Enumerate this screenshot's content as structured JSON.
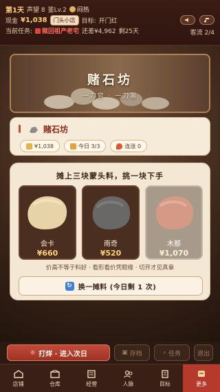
{
  "status": {
    "day": "第1天",
    "reputation": "声望 8",
    "eye": "鉴Lv.2",
    "heat": "闷热",
    "cash_label": "现金",
    "cash": "¥1,038",
    "shop_badge": "门头小店",
    "goal_label": "目标:",
    "goal": "开门红",
    "task_label": "当前任务:",
    "task_name": "赎回祖产老宅",
    "task_gap": "还差¥4,962",
    "task_days": "剩25天",
    "guests": "客流 2/4"
  },
  "banner": {
    "title": "赌石坊",
    "subtitle": "一刀穷 · 一刀富"
  },
  "info": {
    "title": "赌石坊",
    "chips": [
      {
        "label": "¥1,038",
        "icon": "coin-icon"
      },
      {
        "label": "今日 3/3",
        "icon": "ticket-icon"
      },
      {
        "label": "连涨 0",
        "icon": "fire-icon"
      }
    ]
  },
  "panel": {
    "title": "摊上三块蒙头料，挑一块下手",
    "stones": [
      {
        "name": "会卡",
        "price": "¥660"
      },
      {
        "name": "南奇",
        "price": "¥520"
      },
      {
        "name": "木那",
        "price": "¥1,070"
      }
    ],
    "hint": "价高不等于料好 · 看形看价凭眼缘 · 切开才见真章",
    "refresh": "换一摊料 (今日剩 1 次)"
  },
  "actions": {
    "main": "打烊 · 进入次日",
    "save": "存档",
    "task": "任务",
    "exit": "退出"
  },
  "nav": [
    {
      "label": "店铺",
      "icon": "shop-icon"
    },
    {
      "label": "仓库",
      "icon": "warehouse-icon"
    },
    {
      "label": "经营",
      "icon": "ledger-icon"
    },
    {
      "label": "人脉",
      "icon": "people-icon"
    },
    {
      "label": "目标",
      "icon": "target-icon"
    },
    {
      "label": "更多",
      "icon": "more-icon"
    }
  ],
  "colors": {
    "accent": "#b63a2b",
    "gold": "#ffd27a",
    "panel": "#f4e7d3"
  }
}
